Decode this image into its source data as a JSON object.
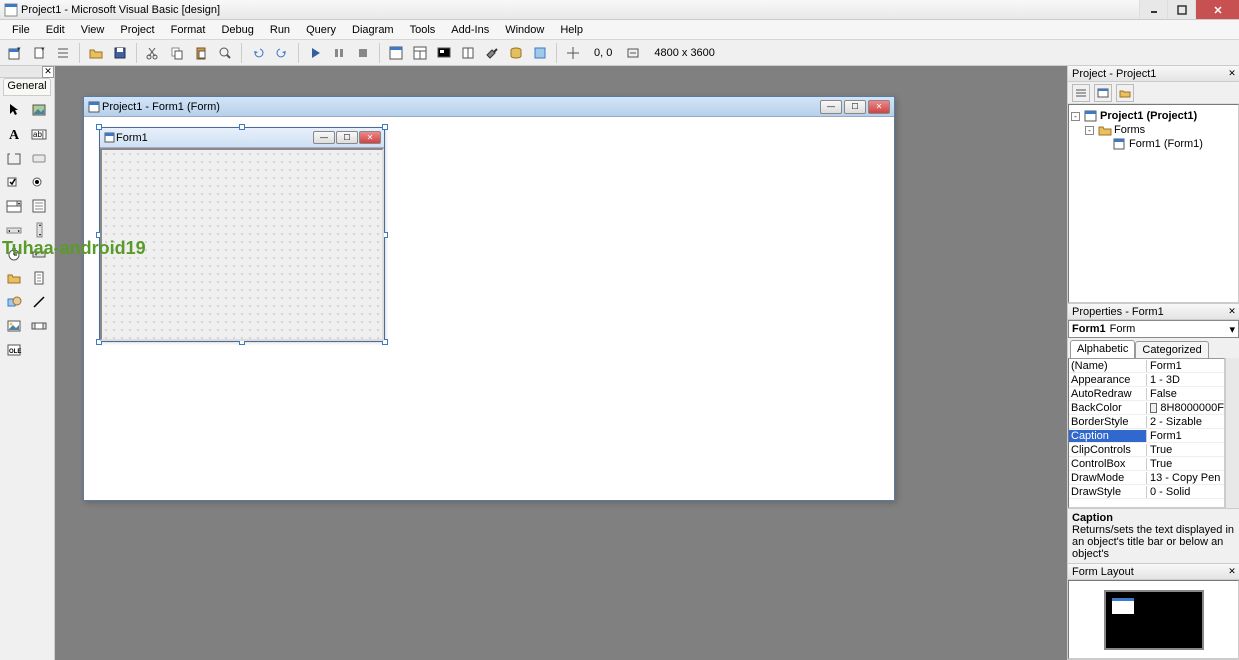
{
  "title": "Project1 - Microsoft Visual Basic [design]",
  "menu": [
    "File",
    "Edit",
    "View",
    "Project",
    "Format",
    "Debug",
    "Run",
    "Query",
    "Diagram",
    "Tools",
    "Add-Ins",
    "Window",
    "Help"
  ],
  "status_coords": "0, 0",
  "status_size": "4800 x 3600",
  "toolbox_tab": "General",
  "mdi_title": "Project1 - Form1 (Form)",
  "form_title": "Form1",
  "watermark_text": "Tuhaa-android19",
  "project_panel": "Project - Project1",
  "tree": {
    "root": "Project1 (Project1)",
    "folder": "Forms",
    "form": "Form1 (Form1)"
  },
  "properties_panel": "Properties - Form1",
  "prop_combo_name": "Form1",
  "prop_combo_type": "Form",
  "prop_tabs": [
    "Alphabetic",
    "Categorized"
  ],
  "props": [
    {
      "name": "(Name)",
      "value": "Form1"
    },
    {
      "name": "Appearance",
      "value": "1 - 3D"
    },
    {
      "name": "AutoRedraw",
      "value": "False"
    },
    {
      "name": "BackColor",
      "value": "8H8000000F",
      "swatch": true
    },
    {
      "name": "BorderStyle",
      "value": "2 - Sizable"
    },
    {
      "name": "Caption",
      "value": "Form1",
      "selected": true
    },
    {
      "name": "ClipControls",
      "value": "True"
    },
    {
      "name": "ControlBox",
      "value": "True"
    },
    {
      "name": "DrawMode",
      "value": "13 - Copy Pen"
    },
    {
      "name": "DrawStyle",
      "value": "0 - Solid"
    }
  ],
  "prop_desc_title": "Caption",
  "prop_desc_text": "Returns/sets the text displayed in an object's title bar or below an object's",
  "form_layout_panel": "Form Layout"
}
